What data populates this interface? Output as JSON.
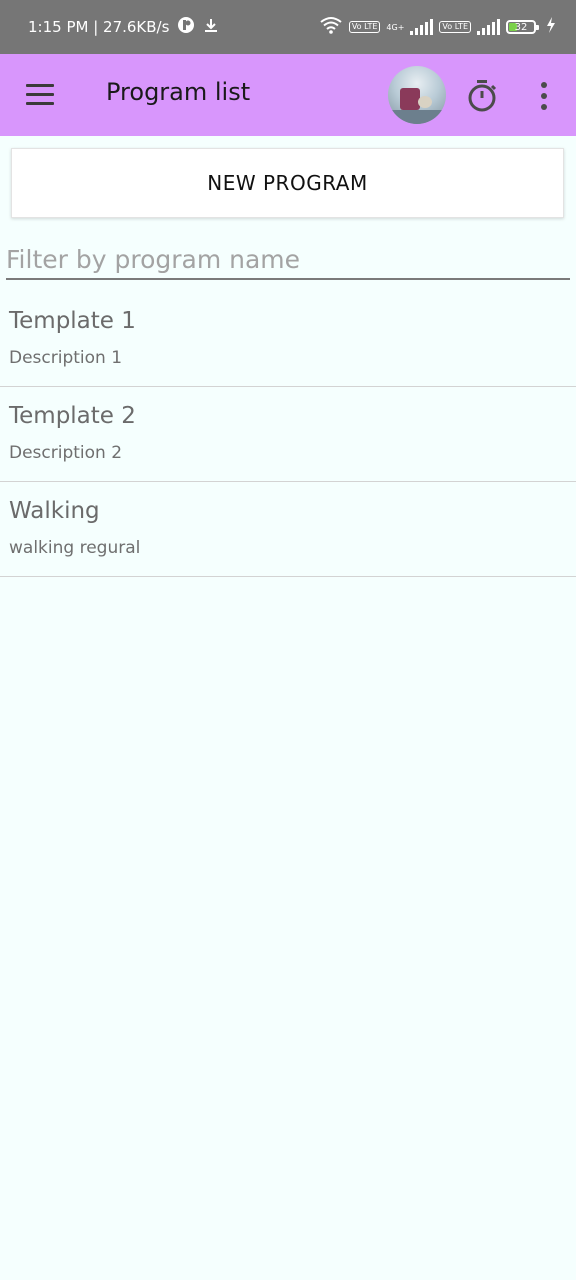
{
  "status_bar": {
    "time_speed": "1:15 PM | 27.6KB/s",
    "network_badge": "4G+",
    "volte_badge_1": "Vo LTE",
    "volte_badge_2": "Vo LTE",
    "battery_level": "32",
    "battery_fraction": 0.32,
    "icons": [
      "app-notification-icon",
      "download-icon",
      "wifi-icon",
      "signal-icon",
      "signal-icon",
      "battery-icon",
      "charging-icon"
    ]
  },
  "app_bar": {
    "title": "Program list",
    "background_color": "#d896fc",
    "icons": [
      "hamburger-menu-icon",
      "avatar",
      "timer-icon",
      "more-vert-icon"
    ]
  },
  "new_program_button": {
    "label": "NEW PROGRAM"
  },
  "filter": {
    "placeholder": "Filter by program name",
    "value": ""
  },
  "programs": [
    {
      "name": "Template 1",
      "description": "Description 1"
    },
    {
      "name": "Template 2",
      "description": "Description 2"
    },
    {
      "name": "Walking",
      "description": "walking regural"
    }
  ]
}
